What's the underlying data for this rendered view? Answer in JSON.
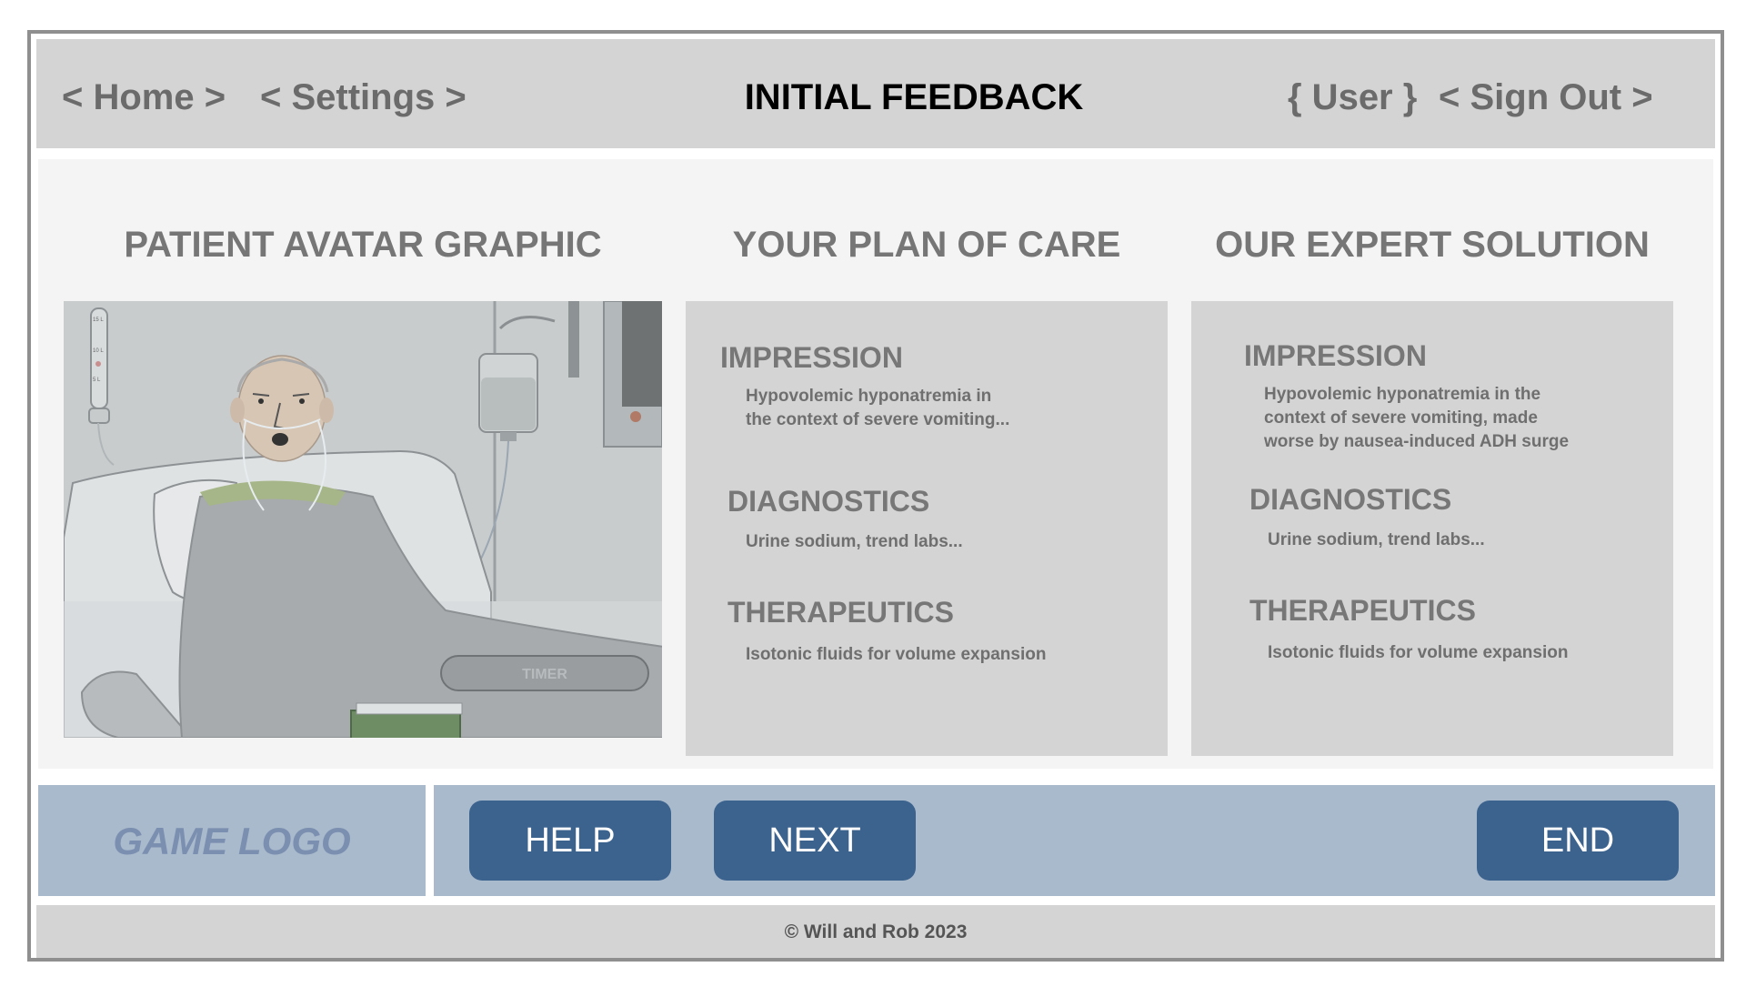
{
  "header": {
    "home_link": "< Home >",
    "settings_link": "< Settings >",
    "title": "INITIAL FEEDBACK",
    "user_link": "{ User }",
    "signout_link": "< Sign Out >"
  },
  "columns": {
    "avatar_title": "PATIENT AVATAR GRAPHIC",
    "plan_title": "YOUR PLAN OF CARE",
    "expert_title": "OUR EXPERT SOLUTION"
  },
  "avatar": {
    "timer_label": "TIMER",
    "iv_marks": [
      "15 L",
      "10 L",
      "5 L"
    ]
  },
  "plan": {
    "impression_head": "IMPRESSION",
    "impression_lines": [
      "Hypovolemic hyponatremia in",
      "the context of severe vomiting..."
    ],
    "diagnostics_head": "DIAGNOSTICS",
    "diagnostics_text": "Urine sodium, trend labs...",
    "therapeutics_head": "THERAPEUTICS",
    "therapeutics_text": "Isotonic fluids for volume expansion"
  },
  "expert": {
    "impression_head": "IMPRESSION",
    "impression_lines": [
      "Hypovolemic hyponatremia in the",
      "context of severe vomiting, made",
      "worse by nausea-induced ADH surge"
    ],
    "diagnostics_head": "DIAGNOSTICS",
    "diagnostics_text": "Urine sodium, trend labs...",
    "therapeutics_head": "THERAPEUTICS",
    "therapeutics_text": "Isotonic fluids for volume expansion"
  },
  "bottom": {
    "logo": "GAME LOGO",
    "help_label": "HELP",
    "next_label": "NEXT",
    "end_label": "END"
  },
  "footer": {
    "copyright": "© Will and Rob 2023"
  },
  "colors": {
    "header_bg": "#d4d4d4",
    "main_bg": "#f4f4f4",
    "bottom_bar_bg": "#a9bacc",
    "button_bg": "#3c628e"
  }
}
